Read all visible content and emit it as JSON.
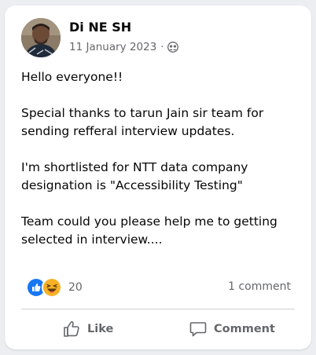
{
  "post": {
    "author": "Di NE SH",
    "date": "11 January 2023",
    "separator": "·",
    "audience_icon": "friends-icon",
    "paragraphs": [
      "Hello everyone!!",
      "Special thanks to tarun Jain sir team for sending refferal interview updates.",
      "I'm shortlisted for NTT data company designation is \"Accessibility Testing\"",
      "Team could you please help me to getting selected in interview...."
    ]
  },
  "reactions": {
    "types": [
      "like",
      "haha"
    ],
    "count": "20"
  },
  "comments": {
    "label": "1 comment"
  },
  "actions": {
    "like_label": "Like",
    "comment_label": "Comment"
  },
  "colors": {
    "like_blue": "#1877f2",
    "haha_yellow": "#f7b125",
    "secondary_text": "#65676b"
  }
}
